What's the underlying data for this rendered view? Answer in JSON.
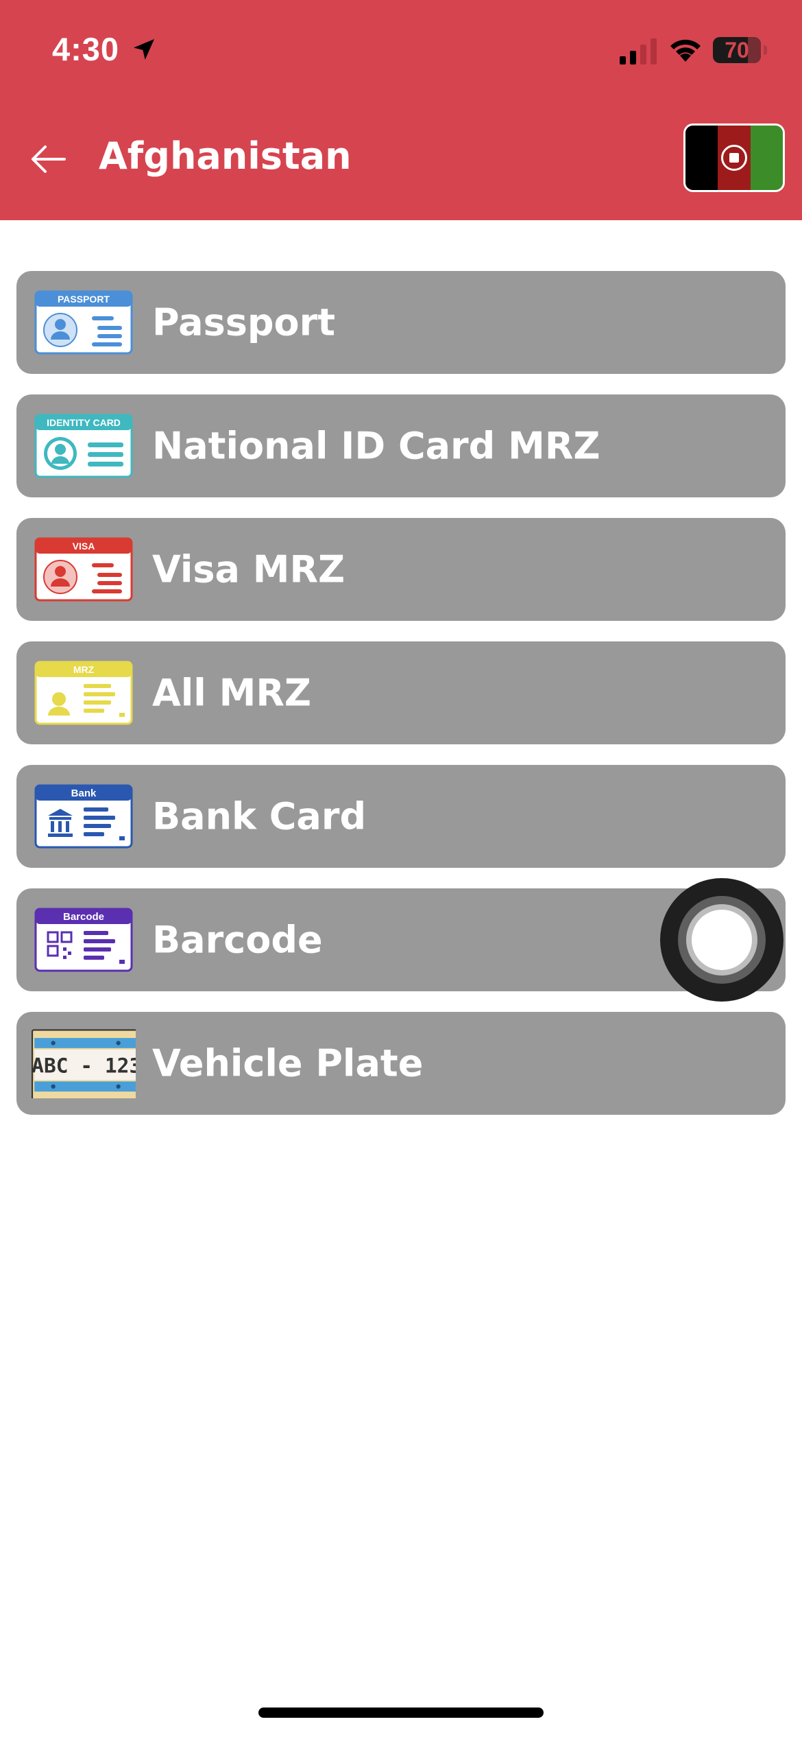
{
  "status_bar": {
    "time": "4:30",
    "battery": "70",
    "icons": [
      "location-arrow-icon",
      "cellular-signal-icon",
      "wifi-icon",
      "battery-icon"
    ]
  },
  "header": {
    "title": "Afghanistan",
    "back_icon": "arrow-left-icon",
    "flag": "afghanistan-flag",
    "background_color": "#d6444f"
  },
  "documents": [
    {
      "label": "Passport",
      "icon": "passport-card-icon",
      "icon_text": "PASSPORT",
      "color": "#4a8fd8"
    },
    {
      "label": "National ID Card MRZ",
      "icon": "identity-card-icon",
      "icon_text": "IDENTITY CARD",
      "color": "#3fb8c0"
    },
    {
      "label": "Visa MRZ",
      "icon": "visa-card-icon",
      "icon_text": "VISA",
      "color": "#d93a32"
    },
    {
      "label": "All MRZ",
      "icon": "mrz-card-icon",
      "icon_text": "MRZ",
      "color": "#e6d94a"
    },
    {
      "label": "Bank Card",
      "icon": "bank-card-icon",
      "icon_text": "Bank",
      "color": "#2a58b0"
    },
    {
      "label": "Barcode",
      "icon": "barcode-card-icon",
      "icon_text": "Barcode",
      "color": "#5a2fb0"
    },
    {
      "label": "Vehicle Plate",
      "icon": "vehicle-plate-icon",
      "icon_text": "ABC - 123",
      "color": "#4a9fd8"
    }
  ],
  "item_background": "#999999"
}
